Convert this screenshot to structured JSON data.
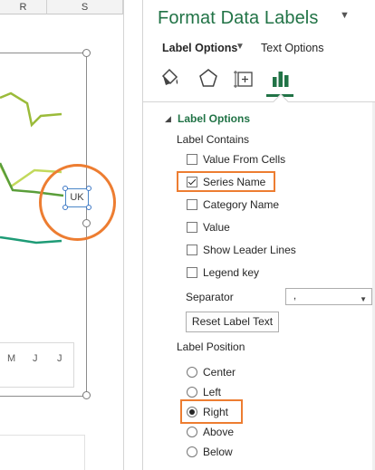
{
  "sheet": {
    "columns": [
      "R",
      "S"
    ],
    "months": [
      "M",
      "J",
      "J"
    ],
    "data_label": "UK"
  },
  "pane": {
    "title": "Format Data Labels",
    "tabs": {
      "label_options": "Label Options",
      "text_options": "Text Options"
    },
    "icons": [
      "fill-line-icon",
      "effects-icon",
      "size-properties-icon",
      "label-options-icon"
    ],
    "section_title": "Label Options",
    "label_contains": {
      "header": "Label Contains",
      "options": [
        {
          "label": "Value From Cells",
          "checked": false
        },
        {
          "label": "Series Name",
          "checked": true
        },
        {
          "label": "Category Name",
          "checked": false
        },
        {
          "label": "Value",
          "checked": false
        },
        {
          "label": "Show Leader Lines",
          "checked": false
        },
        {
          "label": "Legend key",
          "checked": false
        }
      ]
    },
    "separator": {
      "label": "Separator",
      "value": ","
    },
    "reset_button": "Reset Label Text",
    "label_position": {
      "header": "Label Position",
      "options": [
        {
          "label": "Center",
          "selected": false
        },
        {
          "label": "Left",
          "selected": false
        },
        {
          "label": "Right",
          "selected": true
        },
        {
          "label": "Above",
          "selected": false
        },
        {
          "label": "Below",
          "selected": false
        }
      ]
    },
    "accent_color": "#217346",
    "highlight_color": "#ed7d31"
  }
}
